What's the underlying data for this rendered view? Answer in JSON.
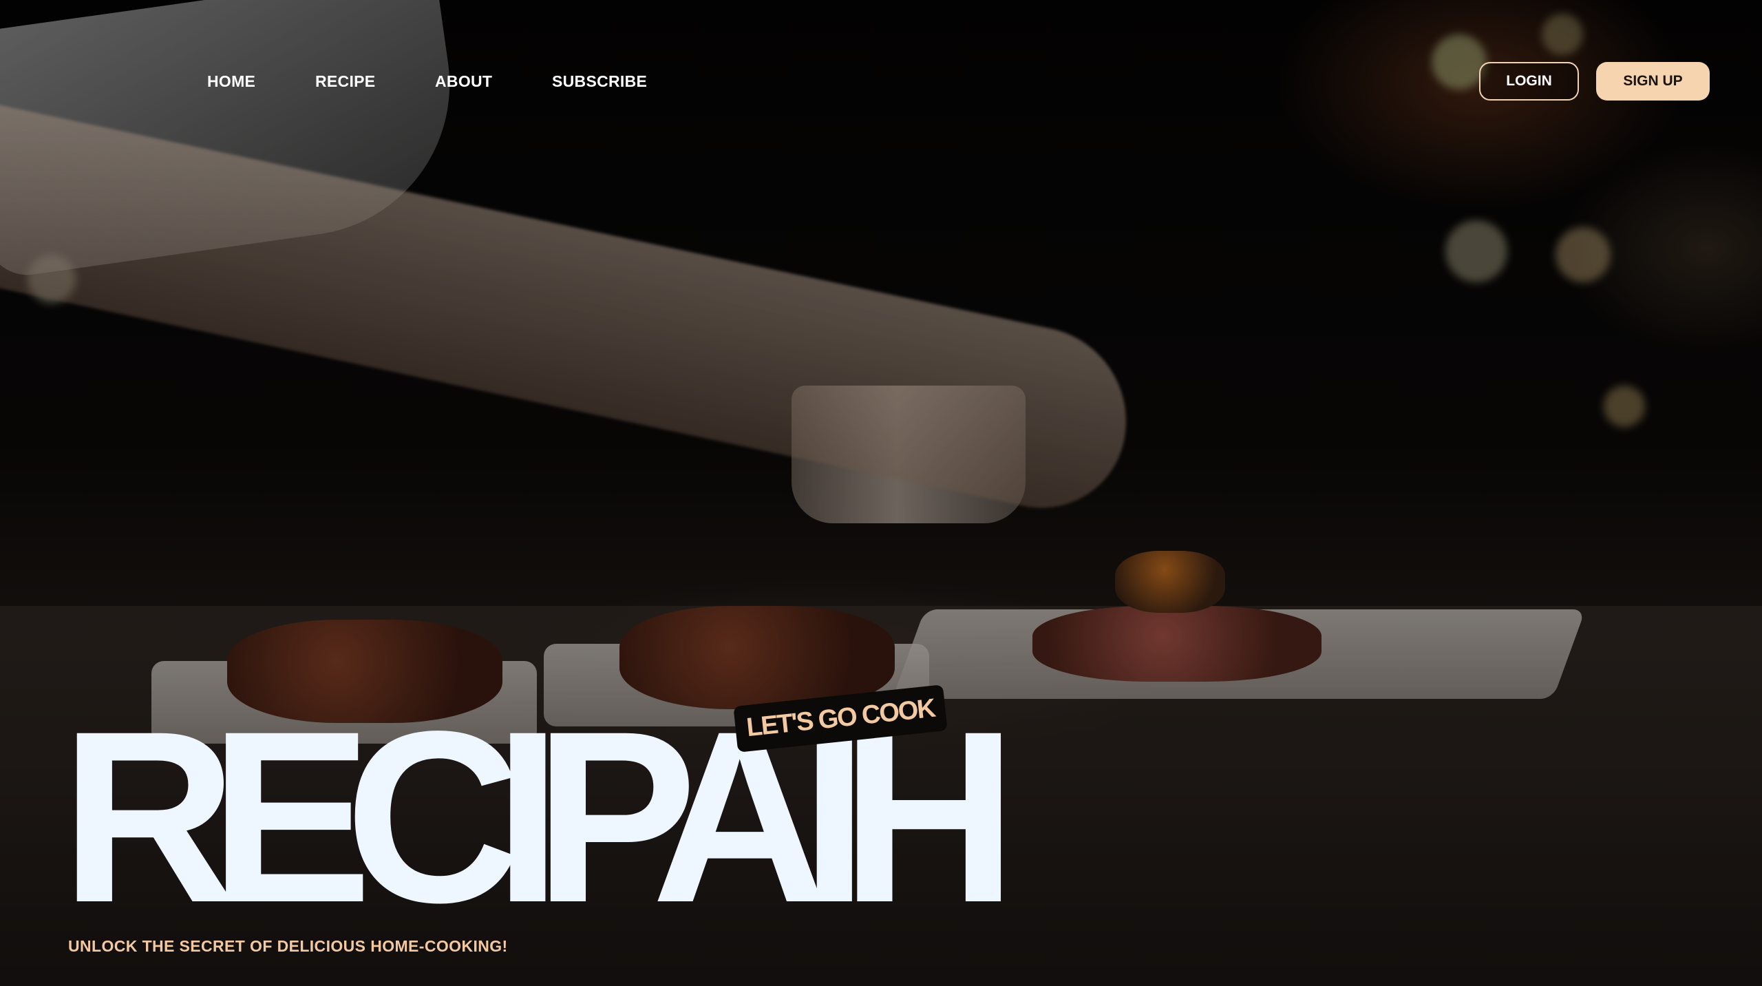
{
  "nav": {
    "links": [
      {
        "label": "HOME"
      },
      {
        "label": "RECIPE"
      },
      {
        "label": "ABOUT"
      },
      {
        "label": "SUBSCRIBE"
      }
    ],
    "login_label": "LOGIN",
    "signup_label": "SIGN UP"
  },
  "hero": {
    "tag": "LET'S GO COOK",
    "title": "RECIPAIH",
    "subtitle": "UNLOCK THE SECRET OF DELICIOUS HOME-COOKING!"
  },
  "colors": {
    "accent": "#f7d4b0",
    "title": "#eef6ff",
    "subtitle": "#f3c9a2"
  }
}
